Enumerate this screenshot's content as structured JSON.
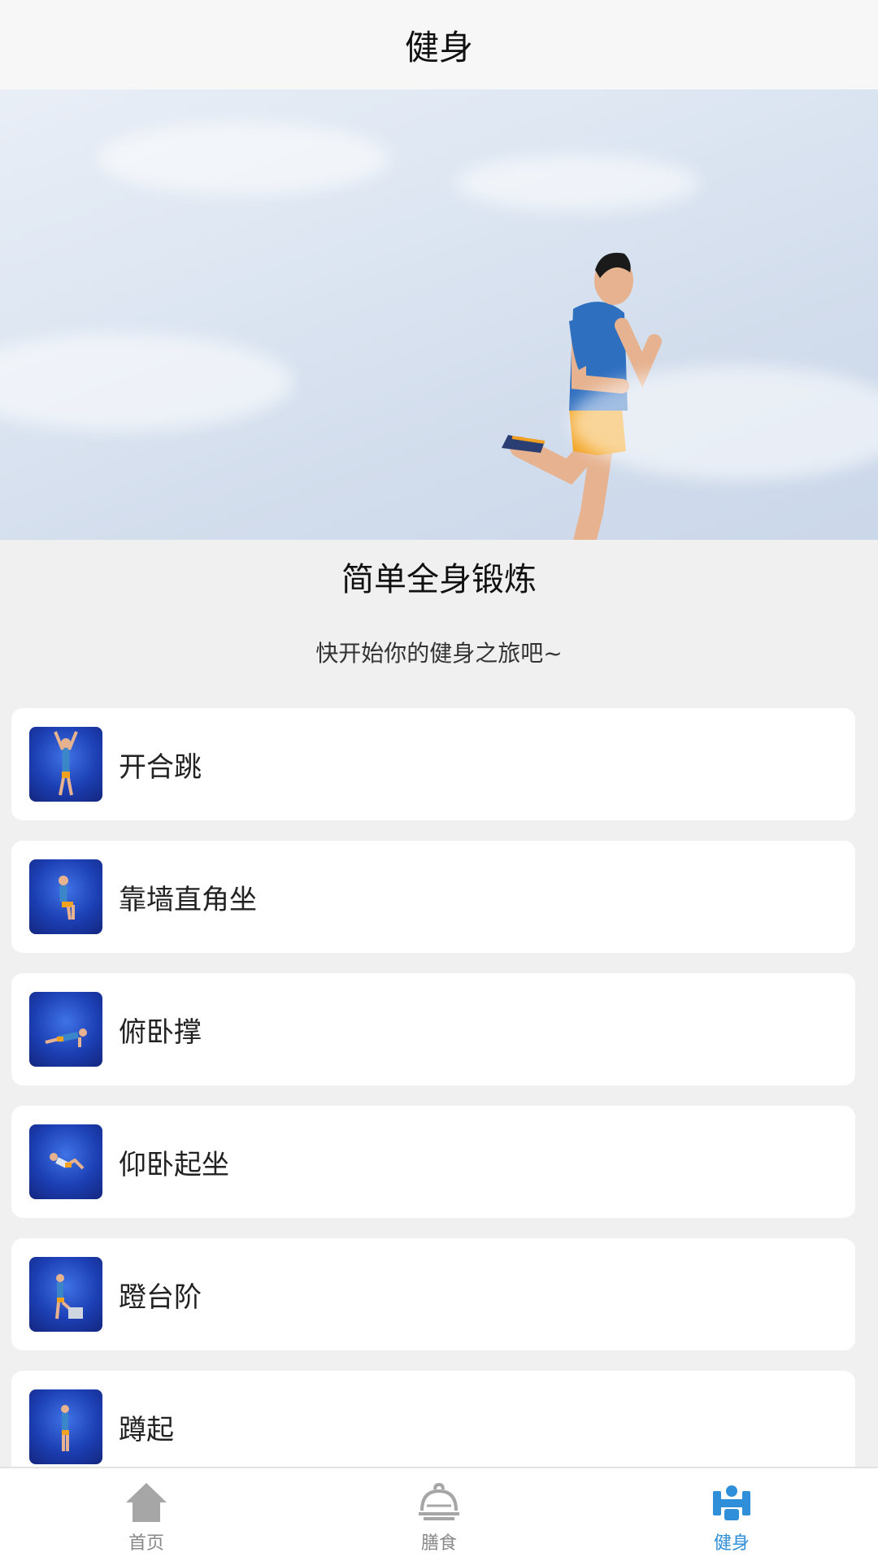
{
  "header": {
    "title": "健身"
  },
  "section": {
    "title": "简单全身锻炼",
    "subtitle": "快开始你的健身之旅吧~"
  },
  "exercises": [
    {
      "label": "开合跳"
    },
    {
      "label": "靠墙直角坐"
    },
    {
      "label": "俯卧撑"
    },
    {
      "label": "仰卧起坐"
    },
    {
      "label": "蹬台阶"
    },
    {
      "label": "蹲起"
    }
  ],
  "bottom_nav": {
    "items": [
      {
        "label": "首页",
        "icon": "home-icon",
        "active": false
      },
      {
        "label": "膳食",
        "icon": "cloche-icon",
        "active": false
      },
      {
        "label": "健身",
        "icon": "fitness-icon",
        "active": true
      }
    ]
  },
  "colors": {
    "accent": "#2f8fd8",
    "inactive": "#999999",
    "thumb_blue": "#1c3fb4"
  }
}
